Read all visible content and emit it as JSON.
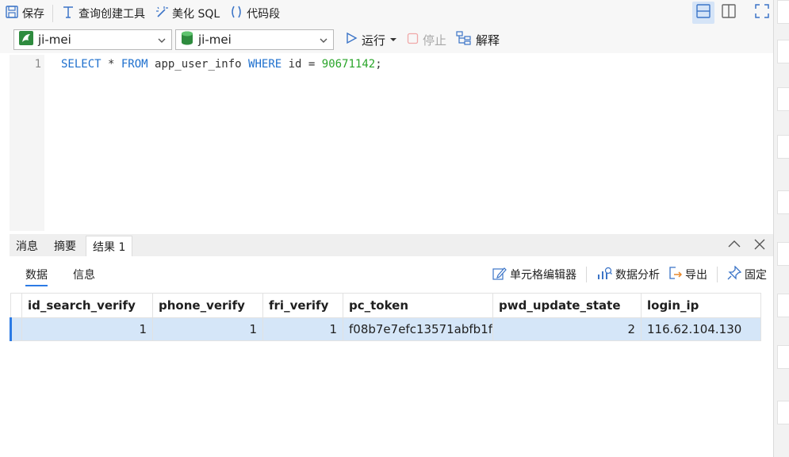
{
  "toolbar": {
    "save": "保存",
    "query_builder": "查询创建工具",
    "beautify": "美化 SQL",
    "snippet": "代码段"
  },
  "connection": {
    "conn_name": "ji-mei",
    "db_name": "ji-mei",
    "run": "运行",
    "stop": "停止",
    "explain": "解释"
  },
  "editor": {
    "line_number": "1",
    "tokens": {
      "kw_select": "SELECT",
      "star": " * ",
      "kw_from": "FROM",
      "table": " app_user_info ",
      "kw_where": "WHERE",
      "cond": " id = ",
      "value": "90671142",
      "end": ";"
    }
  },
  "result_tabs": [
    "消息",
    "摘要",
    "结果 1"
  ],
  "sub_tabs": {
    "data": "数据",
    "info": "信息"
  },
  "tools": {
    "cell_editor": "单元格编辑器",
    "analysis": "数据分析",
    "export": "导出",
    "pin": "固定"
  },
  "grid": {
    "columns": [
      "id_search_verify",
      "phone_verify",
      "fri_verify",
      "pc_token",
      "pwd_update_state",
      "login_ip"
    ],
    "rows": [
      [
        "1",
        "1",
        "1",
        "f08b7e7efc13571abfb1f",
        "2",
        "116.62.104.130"
      ]
    ]
  },
  "colors": {
    "accent": "#2c7be5",
    "keyword": "#1d6fce",
    "number": "#2aa52a",
    "row_selected": "#d5e6f8"
  }
}
